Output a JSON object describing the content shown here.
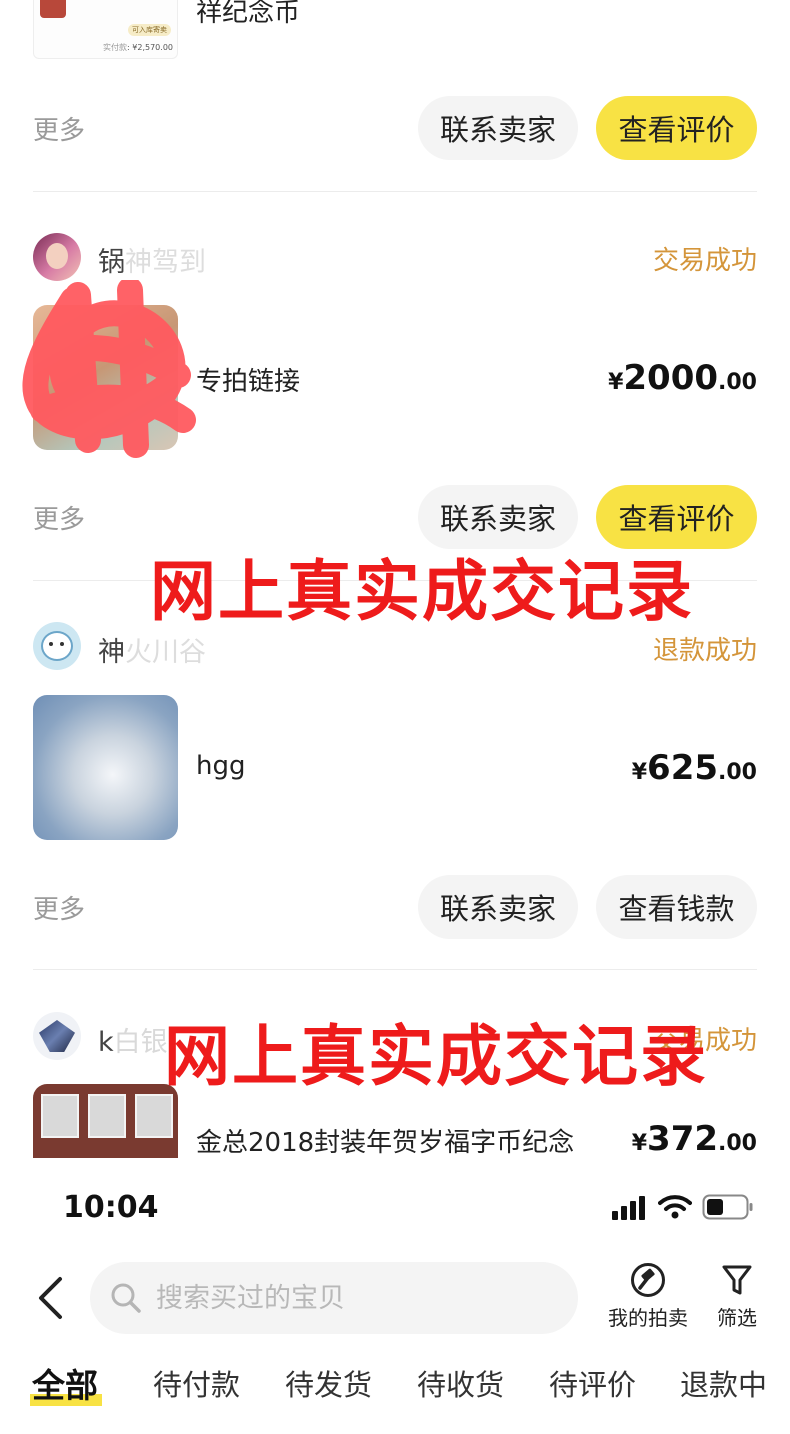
{
  "orders": [
    {
      "title": "祥纪念币",
      "snapshot": {
        "badge": "可入库寄卖",
        "paid_label": "实付款",
        "paid_value": "¥2,570.00"
      },
      "more_label": "更多",
      "buttons": [
        "联系卖家",
        "查看评价"
      ]
    },
    {
      "seller": "锅神驾到",
      "status": "交易成功",
      "title": "专拍链接",
      "price_currency": "¥",
      "price_int": "2000",
      "price_dec": ".00",
      "more_label": "更多",
      "buttons": [
        "联系卖家",
        "查看评价"
      ]
    },
    {
      "seller": "神火川谷",
      "status": "退款成功",
      "title": "hgg",
      "price_currency": "¥",
      "price_int": "625",
      "price_dec": ".00",
      "more_label": "更多",
      "buttons": [
        "联系卖家",
        "查看钱款"
      ]
    },
    {
      "seller": "k白银",
      "status": "交易成功",
      "title": "金总2018封装年贺岁福字币纪念",
      "price_currency": "¥",
      "price_int": "372",
      "price_dec": ".00"
    }
  ],
  "watermark": "网上真实成交记录",
  "status_bar": {
    "time": "10:04"
  },
  "search": {
    "placeholder": "搜索买过的宝贝"
  },
  "toolbar": {
    "my_auction_label": "我的拍卖",
    "filter_label": "筛选"
  },
  "tabs": [
    "全部",
    "待付款",
    "待发货",
    "待收货",
    "待评价",
    "退款中"
  ],
  "colors": {
    "accent_yellow": "#f8e244",
    "status_orange": "#d4953a",
    "watermark_red": "#ee1b1b"
  }
}
